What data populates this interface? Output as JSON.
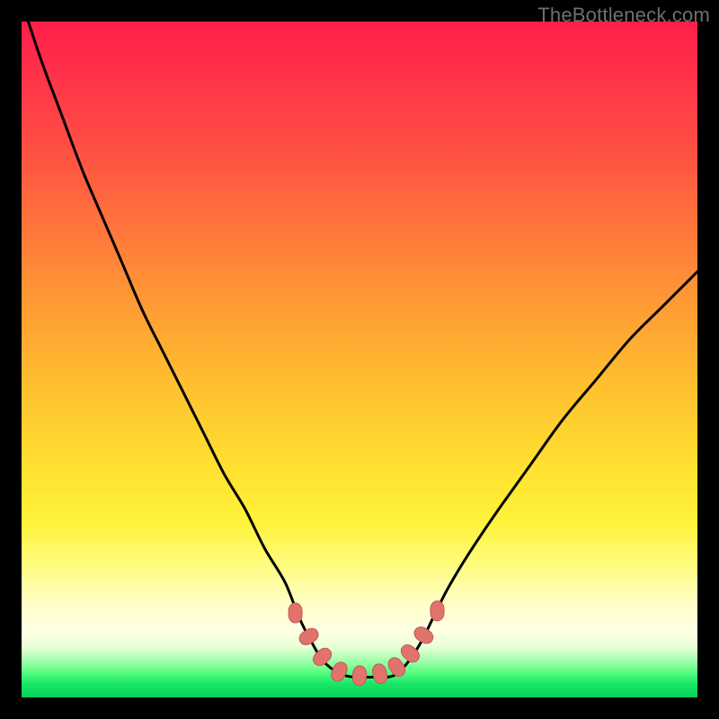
{
  "watermark": "TheBottleneck.com",
  "colors": {
    "background": "#000000",
    "gradient_top": "#ff1f49",
    "gradient_mid": "#ffe12f",
    "gradient_bottom": "#06d157",
    "curve": "#000000",
    "markers_fill": "#e0736c",
    "markers_stroke": "#c25a53"
  },
  "chart_data": {
    "type": "line",
    "title": "",
    "xlabel": "",
    "ylabel": "",
    "xlim": [
      0,
      100
    ],
    "ylim": [
      0,
      100
    ],
    "grid": false,
    "legend": false,
    "note": "No axes or tick labels are rendered; values are estimated from pixel positions on a 0–100 scale for each axis. The curve is a V-shaped bottleneck profile with a flat minimum near y≈3 around x≈44–58.",
    "series": [
      {
        "name": "bottleneck-curve",
        "x": [
          1,
          3,
          6,
          9,
          12,
          15,
          18,
          21,
          24,
          27,
          30,
          33,
          36,
          39,
          41,
          43,
          45,
          48,
          52,
          55,
          57,
          59,
          61,
          63,
          66,
          70,
          75,
          80,
          85,
          90,
          95,
          100
        ],
        "values": [
          100,
          94,
          86,
          78,
          71,
          64,
          57,
          51,
          45,
          39,
          33,
          28,
          22,
          17,
          12,
          8,
          5,
          3.2,
          3,
          3.2,
          5,
          8,
          12,
          16,
          21,
          27,
          34,
          41,
          47,
          53,
          58,
          63
        ]
      }
    ],
    "markers": {
      "name": "highlight-dots",
      "shape": "rounded-rect",
      "x": [
        40.5,
        42.5,
        44.5,
        47,
        50,
        53,
        55.5,
        57.5,
        59.5,
        61.5
      ],
      "values": [
        12.5,
        9,
        6,
        3.8,
        3.2,
        3.5,
        4.5,
        6.5,
        9.2,
        12.8
      ]
    }
  }
}
